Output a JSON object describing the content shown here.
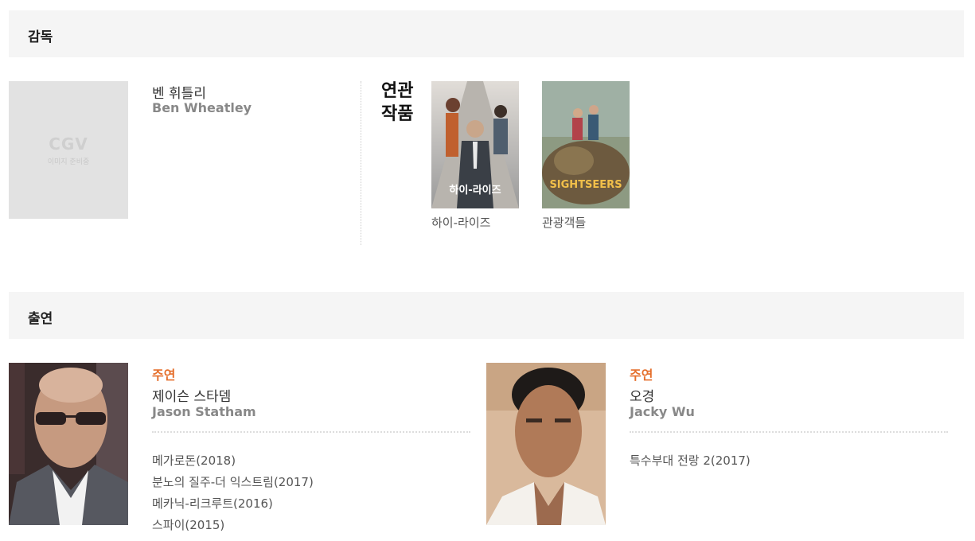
{
  "director_section": {
    "title": "감독",
    "photo_placeholder": {
      "logo": "CGV",
      "caption": "이미지 준비중"
    },
    "director": {
      "name_ko": "벤 휘틀리",
      "name_en": "Ben Wheatley"
    },
    "related": {
      "label_line1": "연관",
      "label_line2": "작품",
      "works": [
        {
          "title": "하이-라이즈",
          "poster_text": "하이-라이즈",
          "poster_colors": [
            "#d8d4ce",
            "#4a4f55"
          ]
        },
        {
          "title": "관광객들",
          "poster_text": "SIGHTSEERS",
          "poster_colors": [
            "#7c8a72",
            "#c49a4a"
          ]
        }
      ]
    }
  },
  "cast_section": {
    "title": "출연",
    "actors": [
      {
        "role": "주연",
        "name_ko": "제이슨 스타뎀",
        "name_en": "Jason Statham",
        "filmography": [
          "메가로돈(2018)",
          "분노의 질주-더 익스트림(2017)",
          "메카닉-리크루트(2016)",
          "스파이(2015)"
        ]
      },
      {
        "role": "주연",
        "name_ko": "오경",
        "name_en": "Jacky Wu",
        "filmography": [
          "특수부대 전랑 2(2017)"
        ]
      }
    ]
  },
  "colors": {
    "accent": "#e56f2c",
    "header_bg": "#f5f5f5",
    "muted_text": "#888888"
  }
}
